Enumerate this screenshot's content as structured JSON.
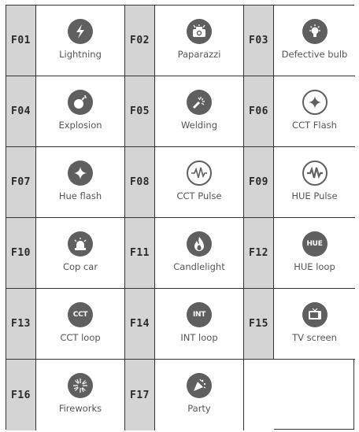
{
  "effects": [
    {
      "code": "F01",
      "label": "Lightning",
      "icon": "lightning-icon"
    },
    {
      "code": "F02",
      "label": "Paparazzi",
      "icon": "camera-icon"
    },
    {
      "code": "F03",
      "label": "Defective bulb",
      "icon": "bulb-icon"
    },
    {
      "code": "F04",
      "label": "Explosion",
      "icon": "bomb-icon"
    },
    {
      "code": "F05",
      "label": "Welding",
      "icon": "welding-icon"
    },
    {
      "code": "F06",
      "label": "CCT Flash",
      "icon": "sparkle-icon"
    },
    {
      "code": "F07",
      "label": "Hue flash",
      "icon": "sparkle-icon"
    },
    {
      "code": "F08",
      "label": "CCT Pulse",
      "icon": "pulse-icon"
    },
    {
      "code": "F09",
      "label": "HUE Pulse",
      "icon": "pulse-icon"
    },
    {
      "code": "F10",
      "label": "Cop car",
      "icon": "siren-icon"
    },
    {
      "code": "F11",
      "label": "Candlelight",
      "icon": "flame-icon"
    },
    {
      "code": "F12",
      "label": "HUE loop",
      "icon": "hue-icon",
      "icon_text": "HUE"
    },
    {
      "code": "F13",
      "label": "CCT loop",
      "icon": "cct-icon",
      "icon_text": "CCT"
    },
    {
      "code": "F14",
      "label": "INT loop",
      "icon": "int-icon",
      "icon_text": "INT"
    },
    {
      "code": "F15",
      "label": "TV screen",
      "icon": "tv-icon"
    },
    {
      "code": "F16",
      "label": "Fireworks",
      "icon": "fireworks-icon"
    },
    {
      "code": "F17",
      "label": "Party",
      "icon": "party-icon"
    }
  ],
  "colors": {
    "code_bg": "#d4d4d4",
    "icon_bg": "#5f5f5f",
    "border": "#333333",
    "label": "#555555"
  }
}
